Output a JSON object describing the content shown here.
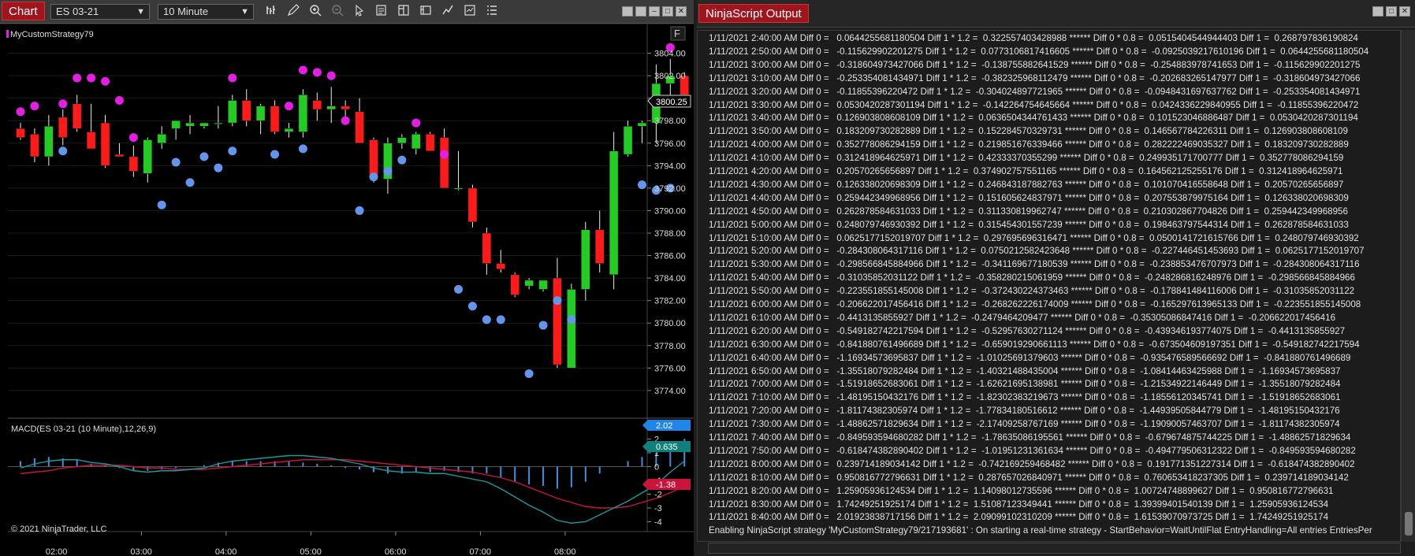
{
  "chart_window": {
    "tab_label": "Chart",
    "instrument": "ES 03-21",
    "interval": "10 Minute",
    "toolbar_icons": [
      "bar-type-icon",
      "draw-pencil-icon",
      "zoom-in-icon",
      "zoom-out-icon",
      "pointer-icon",
      "data-box-icon",
      "chart-trader-icon",
      "templates-icon",
      "strategies-icon",
      "indicators-icon",
      "properties-icon",
      "list-icon"
    ],
    "window_buttons": [
      "tile-icon",
      "restore-icon",
      "maximize-icon",
      "close-icon"
    ],
    "strategy_label": "MyCustomStrategy79",
    "f_button": "F",
    "current_price_label": "3800.25",
    "macd_label": "MACD(ES 03-21 (10 Minute),12,26,9)",
    "macd_value_labels": [
      "2.02",
      "0.635",
      "-1.38"
    ],
    "copyright": "© 2021 NinjaTrader, LLC",
    "colors": {
      "up": "#22cc22",
      "down": "#ff1a1a",
      "magenta_dot": "#e51ee5",
      "blue_dot": "#6495ed",
      "macd": "#1a9a9a",
      "signal": "#c8143c",
      "histogram": "#3d8fe0"
    }
  },
  "chart_data": [
    {
      "type": "candlestick",
      "title": "",
      "x_tick_labels": [
        "02:00",
        "03:00",
        "04:00",
        "05:00",
        "06:00",
        "07:00",
        "08:00"
      ],
      "y_tick_labels": [
        "3804.00",
        "3802.00",
        "3800.00",
        "3798.00",
        "3796.00",
        "3794.00",
        "3792.00",
        "3790.00",
        "3788.00",
        "3786.00",
        "3784.00",
        "3782.00",
        "3780.00",
        "3778.00",
        "3776.00",
        "3774.00"
      ],
      "ylim": [
        3773.5,
        3806
      ],
      "candles": [
        {
          "o": 3797.3,
          "h": 3797.8,
          "l": 3796.3,
          "c": 3796.5
        },
        {
          "o": 3796.8,
          "h": 3797.3,
          "l": 3794.3,
          "c": 3794.8
        },
        {
          "o": 3794.8,
          "h": 3798.5,
          "l": 3794.0,
          "c": 3797.5
        },
        {
          "o": 3798.3,
          "h": 3799.0,
          "l": 3795.8,
          "c": 3796.5
        },
        {
          "o": 3799.5,
          "h": 3800.3,
          "l": 3797.0,
          "c": 3797.3
        },
        {
          "o": 3797.0,
          "h": 3799.5,
          "l": 3795.5,
          "c": 3795.5
        },
        {
          "o": 3797.8,
          "h": 3798.5,
          "l": 3793.8,
          "c": 3794.0
        },
        {
          "o": 3795.0,
          "h": 3796.0,
          "l": 3794.8,
          "c": 3794.8
        },
        {
          "o": 3794.8,
          "h": 3795.8,
          "l": 3793.0,
          "c": 3793.5
        },
        {
          "o": 3793.3,
          "h": 3796.5,
          "l": 3792.5,
          "c": 3796.3
        },
        {
          "o": 3796.0,
          "h": 3797.5,
          "l": 3795.5,
          "c": 3796.8
        },
        {
          "o": 3797.3,
          "h": 3798.0,
          "l": 3796.3,
          "c": 3798.0
        },
        {
          "o": 3797.5,
          "h": 3798.5,
          "l": 3796.8,
          "c": 3797.8
        },
        {
          "o": 3797.5,
          "h": 3797.8,
          "l": 3797.3,
          "c": 3797.8
        },
        {
          "o": 3797.8,
          "h": 3799.3,
          "l": 3797.3,
          "c": 3797.8
        },
        {
          "o": 3797.8,
          "h": 3800.3,
          "l": 3797.5,
          "c": 3799.8
        },
        {
          "o": 3799.8,
          "h": 3800.8,
          "l": 3797.5,
          "c": 3798.0
        },
        {
          "o": 3798.0,
          "h": 3799.5,
          "l": 3796.8,
          "c": 3799.3
        },
        {
          "o": 3799.3,
          "h": 3799.8,
          "l": 3796.8,
          "c": 3797.0
        },
        {
          "o": 3797.0,
          "h": 3797.8,
          "l": 3796.5,
          "c": 3797.3
        },
        {
          "o": 3797.0,
          "h": 3800.8,
          "l": 3796.5,
          "c": 3800.3
        },
        {
          "o": 3799.8,
          "h": 3800.5,
          "l": 3798.0,
          "c": 3799.0
        },
        {
          "o": 3799.0,
          "h": 3801.0,
          "l": 3797.8,
          "c": 3799.3
        },
        {
          "o": 3799.3,
          "h": 3799.8,
          "l": 3798.3,
          "c": 3799.0
        },
        {
          "o": 3798.8,
          "h": 3800.0,
          "l": 3796.0,
          "c": 3796.0
        },
        {
          "o": 3796.3,
          "h": 3796.5,
          "l": 3792.5,
          "c": 3793.0
        },
        {
          "o": 3792.8,
          "h": 3796.5,
          "l": 3791.5,
          "c": 3796.0
        },
        {
          "o": 3796.0,
          "h": 3796.8,
          "l": 3795.5,
          "c": 3796.5
        },
        {
          "o": 3795.5,
          "h": 3797.0,
          "l": 3795.0,
          "c": 3796.8
        },
        {
          "o": 3796.8,
          "h": 3797.0,
          "l": 3795.3,
          "c": 3795.3
        },
        {
          "o": 3796.5,
          "h": 3797.3,
          "l": 3792.0,
          "c": 3792.0
        },
        {
          "o": 3792.0,
          "h": 3795.3,
          "l": 3791.8,
          "c": 3792.0
        },
        {
          "o": 3792.0,
          "h": 3792.3,
          "l": 3788.5,
          "c": 3789.0
        },
        {
          "o": 3788.0,
          "h": 3788.5,
          "l": 3784.3,
          "c": 3785.3
        },
        {
          "o": 3785.3,
          "h": 3786.5,
          "l": 3784.5,
          "c": 3784.8
        },
        {
          "o": 3784.3,
          "h": 3784.5,
          "l": 3782.3,
          "c": 3782.5
        },
        {
          "o": 3783.3,
          "h": 3784.0,
          "l": 3783.0,
          "c": 3783.8
        },
        {
          "o": 3783.0,
          "h": 3783.5,
          "l": 3782.8,
          "c": 3783.8
        },
        {
          "o": 3784.0,
          "h": 3785.8,
          "l": 3776.0,
          "c": 3776.3
        },
        {
          "o": 3776.0,
          "h": 3783.5,
          "l": 3776.0,
          "c": 3783.0
        },
        {
          "o": 3783.0,
          "h": 3789.0,
          "l": 3782.0,
          "c": 3788.3
        },
        {
          "o": 3788.3,
          "h": 3790.0,
          "l": 3784.5,
          "c": 3785.3
        },
        {
          "o": 3784.3,
          "h": 3797.0,
          "l": 3783.0,
          "c": 3795.3
        },
        {
          "o": 3795.0,
          "h": 3798.0,
          "l": 3794.8,
          "c": 3797.5
        },
        {
          "o": 3797.5,
          "h": 3798.0,
          "l": 3796.0,
          "c": 3797.8
        },
        {
          "o": 3797.8,
          "h": 3803.0,
          "l": 3796.0,
          "c": 3801.3
        },
        {
          "o": 3801.3,
          "h": 3803.5,
          "l": 3800.0,
          "c": 3802.0
        },
        {
          "o": 3802.0,
          "h": 3802.3,
          "l": 3800.0,
          "c": 3800.3
        }
      ],
      "magenta_markers": [
        {
          "i": 0,
          "y": 3798.8
        },
        {
          "i": 1,
          "y": 3799.3
        },
        {
          "i": 3,
          "y": 3799.5
        },
        {
          "i": 4,
          "y": 3801.8
        },
        {
          "i": 5,
          "y": 3801.8
        },
        {
          "i": 6,
          "y": 3801.5
        },
        {
          "i": 7,
          "y": 3799.8
        },
        {
          "i": 8,
          "y": 3796.5
        },
        {
          "i": 15,
          "y": 3801.8
        },
        {
          "i": 19,
          "y": 3799.3
        },
        {
          "i": 20,
          "y": 3802.5
        },
        {
          "i": 21,
          "y": 3802.3
        },
        {
          "i": 22,
          "y": 3802.0
        },
        {
          "i": 23,
          "y": 3798.0
        },
        {
          "i": 28,
          "y": 3797.8
        },
        {
          "i": 30,
          "y": 3795.0
        },
        {
          "i": 46,
          "y": 3804.5
        }
      ],
      "blue_markers": [
        {
          "i": 3,
          "y": 3795.3
        },
        {
          "i": 10,
          "y": 3790.5
        },
        {
          "i": 11,
          "y": 3794.3
        },
        {
          "i": 12,
          "y": 3792.5
        },
        {
          "i": 13,
          "y": 3794.8
        },
        {
          "i": 14,
          "y": 3793.8
        },
        {
          "i": 15,
          "y": 3795.3
        },
        {
          "i": 18,
          "y": 3795.0
        },
        {
          "i": 20,
          "y": 3795.5
        },
        {
          "i": 24,
          "y": 3790.0
        },
        {
          "i": 25,
          "y": 3793.0
        },
        {
          "i": 26,
          "y": 3793.5
        },
        {
          "i": 27,
          "y": 3794.5
        },
        {
          "i": 31,
          "y": 3783.0
        },
        {
          "i": 32,
          "y": 3781.5
        },
        {
          "i": 33,
          "y": 3780.3
        },
        {
          "i": 34,
          "y": 3780.3
        },
        {
          "i": 36,
          "y": 3775.5
        },
        {
          "i": 37,
          "y": 3779.8
        },
        {
          "i": 38,
          "y": 3782.0
        },
        {
          "i": 39,
          "y": 3780.3
        },
        {
          "i": 44,
          "y": 3792.3
        },
        {
          "i": 45,
          "y": 3791.8
        },
        {
          "i": 46,
          "y": 3792.0
        }
      ]
    },
    {
      "type": "line",
      "title": "MACD(ES 03-21 (10 Minute),12,26,9)",
      "y_tick_labels": [
        "3",
        "2",
        "1",
        "0",
        "-1",
        "-2",
        "-3",
        "-4"
      ],
      "ylim": [
        -4.6,
        3.4
      ],
      "series": [
        {
          "name": "MACD",
          "values": [
            -0.1,
            0.2,
            0.4,
            0.5,
            0.5,
            0.3,
            0.2,
            0.0,
            -0.3,
            -0.4,
            -0.3,
            -0.3,
            -0.2,
            -0.1,
            0.2,
            0.4,
            0.5,
            0.6,
            0.7,
            0.8,
            0.8,
            0.7,
            0.6,
            0.4,
            0.2,
            -0.1,
            -0.3,
            -0.4,
            -0.4,
            -0.5,
            -0.5,
            -0.7,
            -0.9,
            -1.1,
            -1.6,
            -2.2,
            -2.8,
            -3.3,
            -3.9,
            -4.1,
            -4.0,
            -3.5,
            -3.0,
            -2.5,
            -1.9,
            -1.3,
            -0.4,
            0.4
          ]
        },
        {
          "name": "Signal",
          "values": [
            -0.5,
            -0.4,
            -0.3,
            -0.1,
            0.0,
            0.1,
            0.1,
            0.1,
            0.0,
            -0.1,
            -0.1,
            -0.2,
            -0.2,
            -0.2,
            -0.1,
            0.0,
            0.1,
            0.2,
            0.3,
            0.4,
            0.5,
            0.5,
            0.5,
            0.5,
            0.4,
            0.3,
            0.2,
            0.1,
            0.0,
            -0.1,
            -0.2,
            -0.3,
            -0.4,
            -0.6,
            -0.8,
            -1.1,
            -1.5,
            -1.9,
            -2.3,
            -2.6,
            -2.9,
            -3.0,
            -3.0,
            -2.9,
            -2.6,
            -2.3,
            -1.9,
            -1.4
          ]
        },
        {
          "name": "Diff",
          "values": [
            0.4,
            0.6,
            0.7,
            0.6,
            0.5,
            0.2,
            0.1,
            -0.1,
            -0.3,
            -0.3,
            -0.2,
            -0.1,
            0.0,
            0.1,
            0.3,
            0.4,
            0.4,
            0.4,
            0.4,
            0.4,
            0.3,
            0.2,
            0.1,
            -0.1,
            -0.2,
            -0.4,
            -0.5,
            -0.5,
            -0.4,
            -0.4,
            -0.3,
            -0.4,
            -0.5,
            -0.5,
            -0.8,
            -1.1,
            -1.3,
            -1.4,
            -1.6,
            -1.5,
            -1.1,
            -0.5,
            0.0,
            0.4,
            0.7,
            1.0,
            1.5,
            2.02
          ]
        }
      ]
    }
  ],
  "output_window": {
    "title": "NinjaScript Output",
    "window_buttons": [
      "restore-icon",
      "maximize-icon",
      "close-icon"
    ],
    "lines": [
      "1/11/2021 2:40:00 AM Diff 0 =   0.0644255681180504 Diff 1 * 1.2 =  0.322557403428988 ****** Diff 0 * 0.8 =  0.0515404544944403 Diff 1 =  0.268797836190824",
      "1/11/2021 2:50:00 AM Diff 0 =   -0.115629902201275 Diff 1 * 1.2 =  0.0773106817416605 ****** Diff 0 * 0.8 =  -0.0925039217610196 Diff 1 =  0.0644255681180504",
      "1/11/2021 3:00:00 AM Diff 0 =   -0.318604973427066 Diff 1 * 1.2 =  -0.138755882641529 ****** Diff 0 * 0.8 =  -0.254883978741653 Diff 1 =  -0.115629902201275",
      "1/11/2021 3:10:00 AM Diff 0 =   -0.253354081434971 Diff 1 * 1.2 =  -0.382325968112479 ****** Diff 0 * 0.8 =  -0.202683265147977 Diff 1 =  -0.318604973427066",
      "1/11/2021 3:20:00 AM Diff 0 =   -0.11855396220472 Diff 1 * 1.2 =  -0.304024897721965 ****** Diff 0 * 0.8 =  -0.0948431697637762 Diff 1 =  -0.253354081434971",
      "1/11/2021 3:30:00 AM Diff 0 =   0.0530420287301194 Diff 1 * 1.2 =  -0.142264754645664 ****** Diff 0 * 0.8 =  0.0424336229840955 Diff 1 =  -0.11855396220472",
      "1/11/2021 3:40:00 AM Diff 0 =   0.126903808608109 Diff 1 * 1.2 =  0.0636504344761433 ****** Diff 0 * 0.8 =  0.101523046886487 Diff 1 =  0.0530420287301194",
      "1/11/2021 3:50:00 AM Diff 0 =   0.183209730282889 Diff 1 * 1.2 =  0.152284570329731 ****** Diff 0 * 0.8 =  0.146567784226311 Diff 1 =  0.126903808608109",
      "1/11/2021 4:00:00 AM Diff 0 =   0.352778086294159 Diff 1 * 1.2 =  0.219851676339466 ****** Diff 0 * 0.8 =  0.282222469035327 Diff 1 =  0.183209730282889",
      "1/11/2021 4:10:00 AM Diff 0 =   0.312418964625971 Diff 1 * 1.2 =  0.42333370355299 ****** Diff 0 * 0.8 =  0.249935171700777 Diff 1 =  0.352778086294159",
      "1/11/2021 4:20:00 AM Diff 0 =   0.20570265656897 Diff 1 * 1.2 =  0.374902757551165 ****** Diff 0 * 0.8 =  0.164562125255176 Diff 1 =  0.312418964625971",
      "1/11/2021 4:30:00 AM Diff 0 =   0.126338020698309 Diff 1 * 1.2 =  0.246843187882763 ****** Diff 0 * 0.8 =  0.101070416558648 Diff 1 =  0.20570265656897",
      "1/11/2021 4:40:00 AM Diff 0 =   0.259442349968956 Diff 1 * 1.2 =  0.151605624837971 ****** Diff 0 * 0.8 =  0.207553879975164 Diff 1 =  0.126338020698309",
      "1/11/2021 4:50:00 AM Diff 0 =   0.262878584631033 Diff 1 * 1.2 =  0.311330819962747 ****** Diff 0 * 0.8 =  0.210302867704826 Diff 1 =  0.259442349968956",
      "1/11/2021 5:00:00 AM Diff 0 =   0.248079746930392 Diff 1 * 1.2 =  0.315454301557239 ****** Diff 0 * 0.8 =  0.198463797544314 Diff 1 =  0.262878584631033",
      "1/11/2021 5:10:00 AM Diff 0 =   0.0625177152019707 Diff 1 * 1.2 =  0.297695696316471 ****** Diff 0 * 0.8 =  0.0500141721615766 Diff 1 =  0.248079746930392",
      "1/11/2021 5:20:00 AM Diff 0 =   -0.284308064317116 Diff 1 * 1.2 =  0.0750212582423648 ****** Diff 0 * 0.8 =  -0.227446451453693 Diff 1 =  0.0625177152019707",
      "1/11/2021 5:30:00 AM Diff 0 =   -0.298566845884966 Diff 1 * 1.2 =  -0.341169677180539 ****** Diff 0 * 0.8 =  -0.238853476707973 Diff 1 =  -0.284308064317116",
      "1/11/2021 5:40:00 AM Diff 0 =   -0.31035852031122 Diff 1 * 1.2 =  -0.358280215061959 ****** Diff 0 * 0.8 =  -0.248286816248976 Diff 1 =  -0.298566845884966",
      "1/11/2021 5:50:00 AM Diff 0 =   -0.223551855145008 Diff 1 * 1.2 =  -0.372430224373463 ****** Diff 0 * 0.8 =  -0.178841484116006 Diff 1 =  -0.31035852031122",
      "1/11/2021 6:00:00 AM Diff 0 =   -0.206622017456416 Diff 1 * 1.2 =  -0.268262226174009 ****** Diff 0 * 0.8 =  -0.165297613965133 Diff 1 =  -0.223551855145008",
      "1/11/2021 6:10:00 AM Diff 0 =   -0.4413135855927 Diff 1 * 1.2 =  -0.2479464209477 ****** Diff 0 * 0.8 =  -0.35305086847416 Diff 1 =  -0.206622017456416",
      "1/11/2021 6:20:00 AM Diff 0 =   -0.549182742217594 Diff 1 * 1.2 =  -0.52957630271124 ****** Diff 0 * 0.8 =  -0.439346193774075 Diff 1 =  -0.4413135855927",
      "1/11/2021 6:30:00 AM Diff 0 =   -0.841880761496689 Diff 1 * 1.2 =  -0.659019290661113 ****** Diff 0 * 0.8 =  -0.673504609197351 Diff 1 =  -0.549182742217594",
      "1/11/2021 6:40:00 AM Diff 0 =   -1.16934573695837 Diff 1 * 1.2 =  -1.01025691379603 ****** Diff 0 * 0.8 =  -0.935476589566692 Diff 1 =  -0.841880761496689",
      "1/11/2021 6:50:00 AM Diff 0 =   -1.35518079282484 Diff 1 * 1.2 =  -1.40321488435004 ****** Diff 0 * 0.8 =  -1.08414463425988 Diff 1 =  -1.16934573695837",
      "1/11/2021 7:00:00 AM Diff 0 =   -1.51918652683061 Diff 1 * 1.2 =  -1.62621695138981 ****** Diff 0 * 0.8 =  -1.21534922146449 Diff 1 =  -1.35518079282484",
      "1/11/2021 7:10:00 AM Diff 0 =   -1.48195150432176 Diff 1 * 1.2 =  -1.82302383219673 ****** Diff 0 * 0.8 =  -1.18556120345741 Diff 1 =  -1.51918652683061",
      "1/11/2021 7:20:00 AM Diff 0 =   -1.81174382305974 Diff 1 * 1.2 =  -1.77834180516612 ****** Diff 0 * 0.8 =  -1.44939505844779 Diff 1 =  -1.48195150432176",
      "1/11/2021 7:30:00 AM Diff 0 =   -1.48862571829634 Diff 1 * 1.2 =  -2.17409258767169 ****** Diff 0 * 0.8 =  -1.19090057463707 Diff 1 =  -1.81174382305974",
      "1/11/2021 7:40:00 AM Diff 0 =   -0.849593594680282 Diff 1 * 1.2 =  -1.78635086195561 ****** Diff 0 * 0.8 =  -0.679674875744225 Diff 1 =  -1.48862571829634",
      "1/11/2021 7:50:00 AM Diff 0 =   -0.618474382890402 Diff 1 * 1.2 =  -1.01951231361634 ****** Diff 0 * 0.8 =  -0.494779506312322 Diff 1 =  -0.849593594680282",
      "1/11/2021 8:00:00 AM Diff 0 =   0.239714189034142 Diff 1 * 1.2 =  -0.742169259468482 ****** Diff 0 * 0.8 =  0.191771351227314 Diff 1 =  -0.618474382890402",
      "1/11/2021 8:10:00 AM Diff 0 =   0.950816772796631 Diff 1 * 1.2 =  0.287657026840971 ****** Diff 0 * 0.8 =  0.760653418237305 Diff 1 =  0.239714189034142",
      "1/11/2021 8:20:00 AM Diff 0 =   1.25905936124534 Diff 1 * 1.2 =  1.14098012735596 ****** Diff 0 * 0.8 =  1.00724748899627 Diff 1 =  0.950816772796631",
      "1/11/2021 8:30:00 AM Diff 0 =   1.74249251925174 Diff 1 * 1.2 =  1.51087123349441 ****** Diff 0 * 0.8 =  1.39399401540139 Diff 1 =  1.25905936124534",
      "1/11/2021 8:40:00 AM Diff 0 =   2.01923838717156 Diff 1 * 1.2 =  2.09099102310209 ****** Diff 0 * 0.8 =  1.61539070973725 Diff 1 =  1.74249251925174",
      "Enabling NinjaScript strategy 'MyCustomStrategy79/217193681' : On starting a real-time strategy - StartBehavior=WaitUntilFlat EntryHandling=All entries EntriesPer"
    ]
  }
}
